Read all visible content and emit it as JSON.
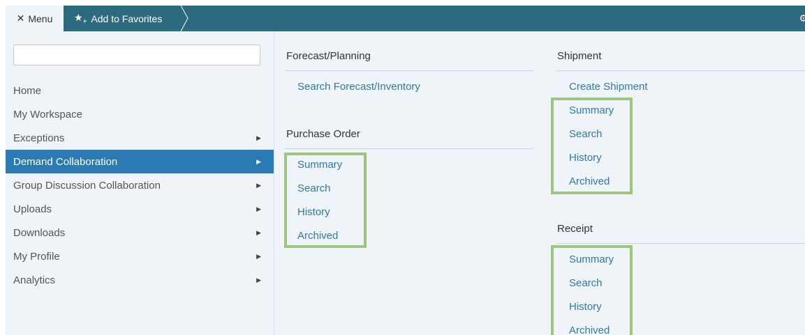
{
  "topbar": {
    "menu_label": "Menu",
    "favorites_label": "Add to Favorites"
  },
  "icons": {
    "close": "close-icon",
    "star": "star-plus-icon",
    "gear": "gear-icon",
    "arrow": "caret-right-icon"
  },
  "colors": {
    "topbar": "#2c6a7f",
    "active": "#2a7ab3",
    "link": "#2f79ad",
    "highlight": "#9bc67b",
    "background": "#eef4f8"
  },
  "sidebar": {
    "search_value": "",
    "items": [
      {
        "label": "Home"
      },
      {
        "label": "My Workspace"
      },
      {
        "label": "Exceptions"
      },
      {
        "label": "Demand Collaboration"
      },
      {
        "label": "Group Discussion Collaboration"
      },
      {
        "label": "Uploads"
      },
      {
        "label": "Downloads"
      },
      {
        "label": "My Profile"
      },
      {
        "label": "Analytics"
      }
    ]
  },
  "sections": {
    "forecast": {
      "title": "Forecast/Planning",
      "links": [
        "Search Forecast/Inventory"
      ]
    },
    "purchase_order": {
      "title": "Purchase Order",
      "links": [
        "Summary",
        "Search",
        "History",
        "Archived"
      ]
    },
    "shipment": {
      "title": "Shipment",
      "links": [
        "Create Shipment",
        "Summary",
        "Search",
        "History",
        "Archived"
      ]
    },
    "receipt": {
      "title": "Receipt",
      "links": [
        "Summary",
        "Search",
        "History",
        "Archived"
      ]
    }
  }
}
